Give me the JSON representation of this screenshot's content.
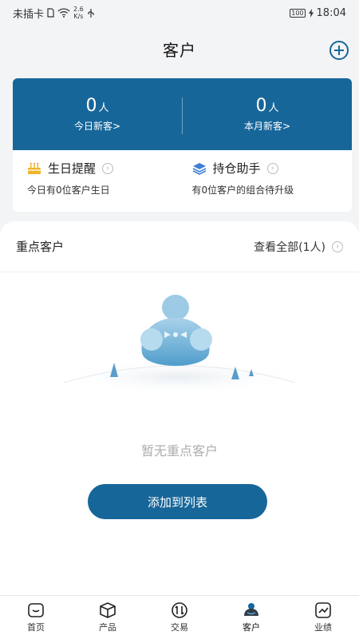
{
  "status": {
    "carrier": "未插卡",
    "net_speed_value": "2.6",
    "net_speed_unit": "K/s",
    "battery": "100",
    "time": "18:04"
  },
  "header": {
    "title": "客户"
  },
  "stats": {
    "today_num": "0",
    "today_unit": "人",
    "today_label": "今日新客>",
    "month_num": "0",
    "month_unit": "人",
    "month_label": "本月新客>"
  },
  "reminders": {
    "birthday_title": "生日提醒",
    "birthday_sub": "今日有0位客户生日",
    "holding_title": "持仓助手",
    "holding_sub": "有0位客户的组合待升级"
  },
  "key_customers": {
    "title": "重点客户",
    "view_all": "查看全部(1人)",
    "empty_text": "暂无重点客户",
    "add_button": "添加到列表"
  },
  "tabs": [
    {
      "label": "首页",
      "icon": "home-icon"
    },
    {
      "label": "产品",
      "icon": "box-icon"
    },
    {
      "label": "交易",
      "icon": "exchange-icon"
    },
    {
      "label": "客户",
      "icon": "customer-icon",
      "active": true
    },
    {
      "label": "业绩",
      "icon": "chart-icon"
    }
  ],
  "colors": {
    "accent": "#17669a",
    "birthday_icon": "#f0b429",
    "holding_icon": "#3f7fd6"
  }
}
